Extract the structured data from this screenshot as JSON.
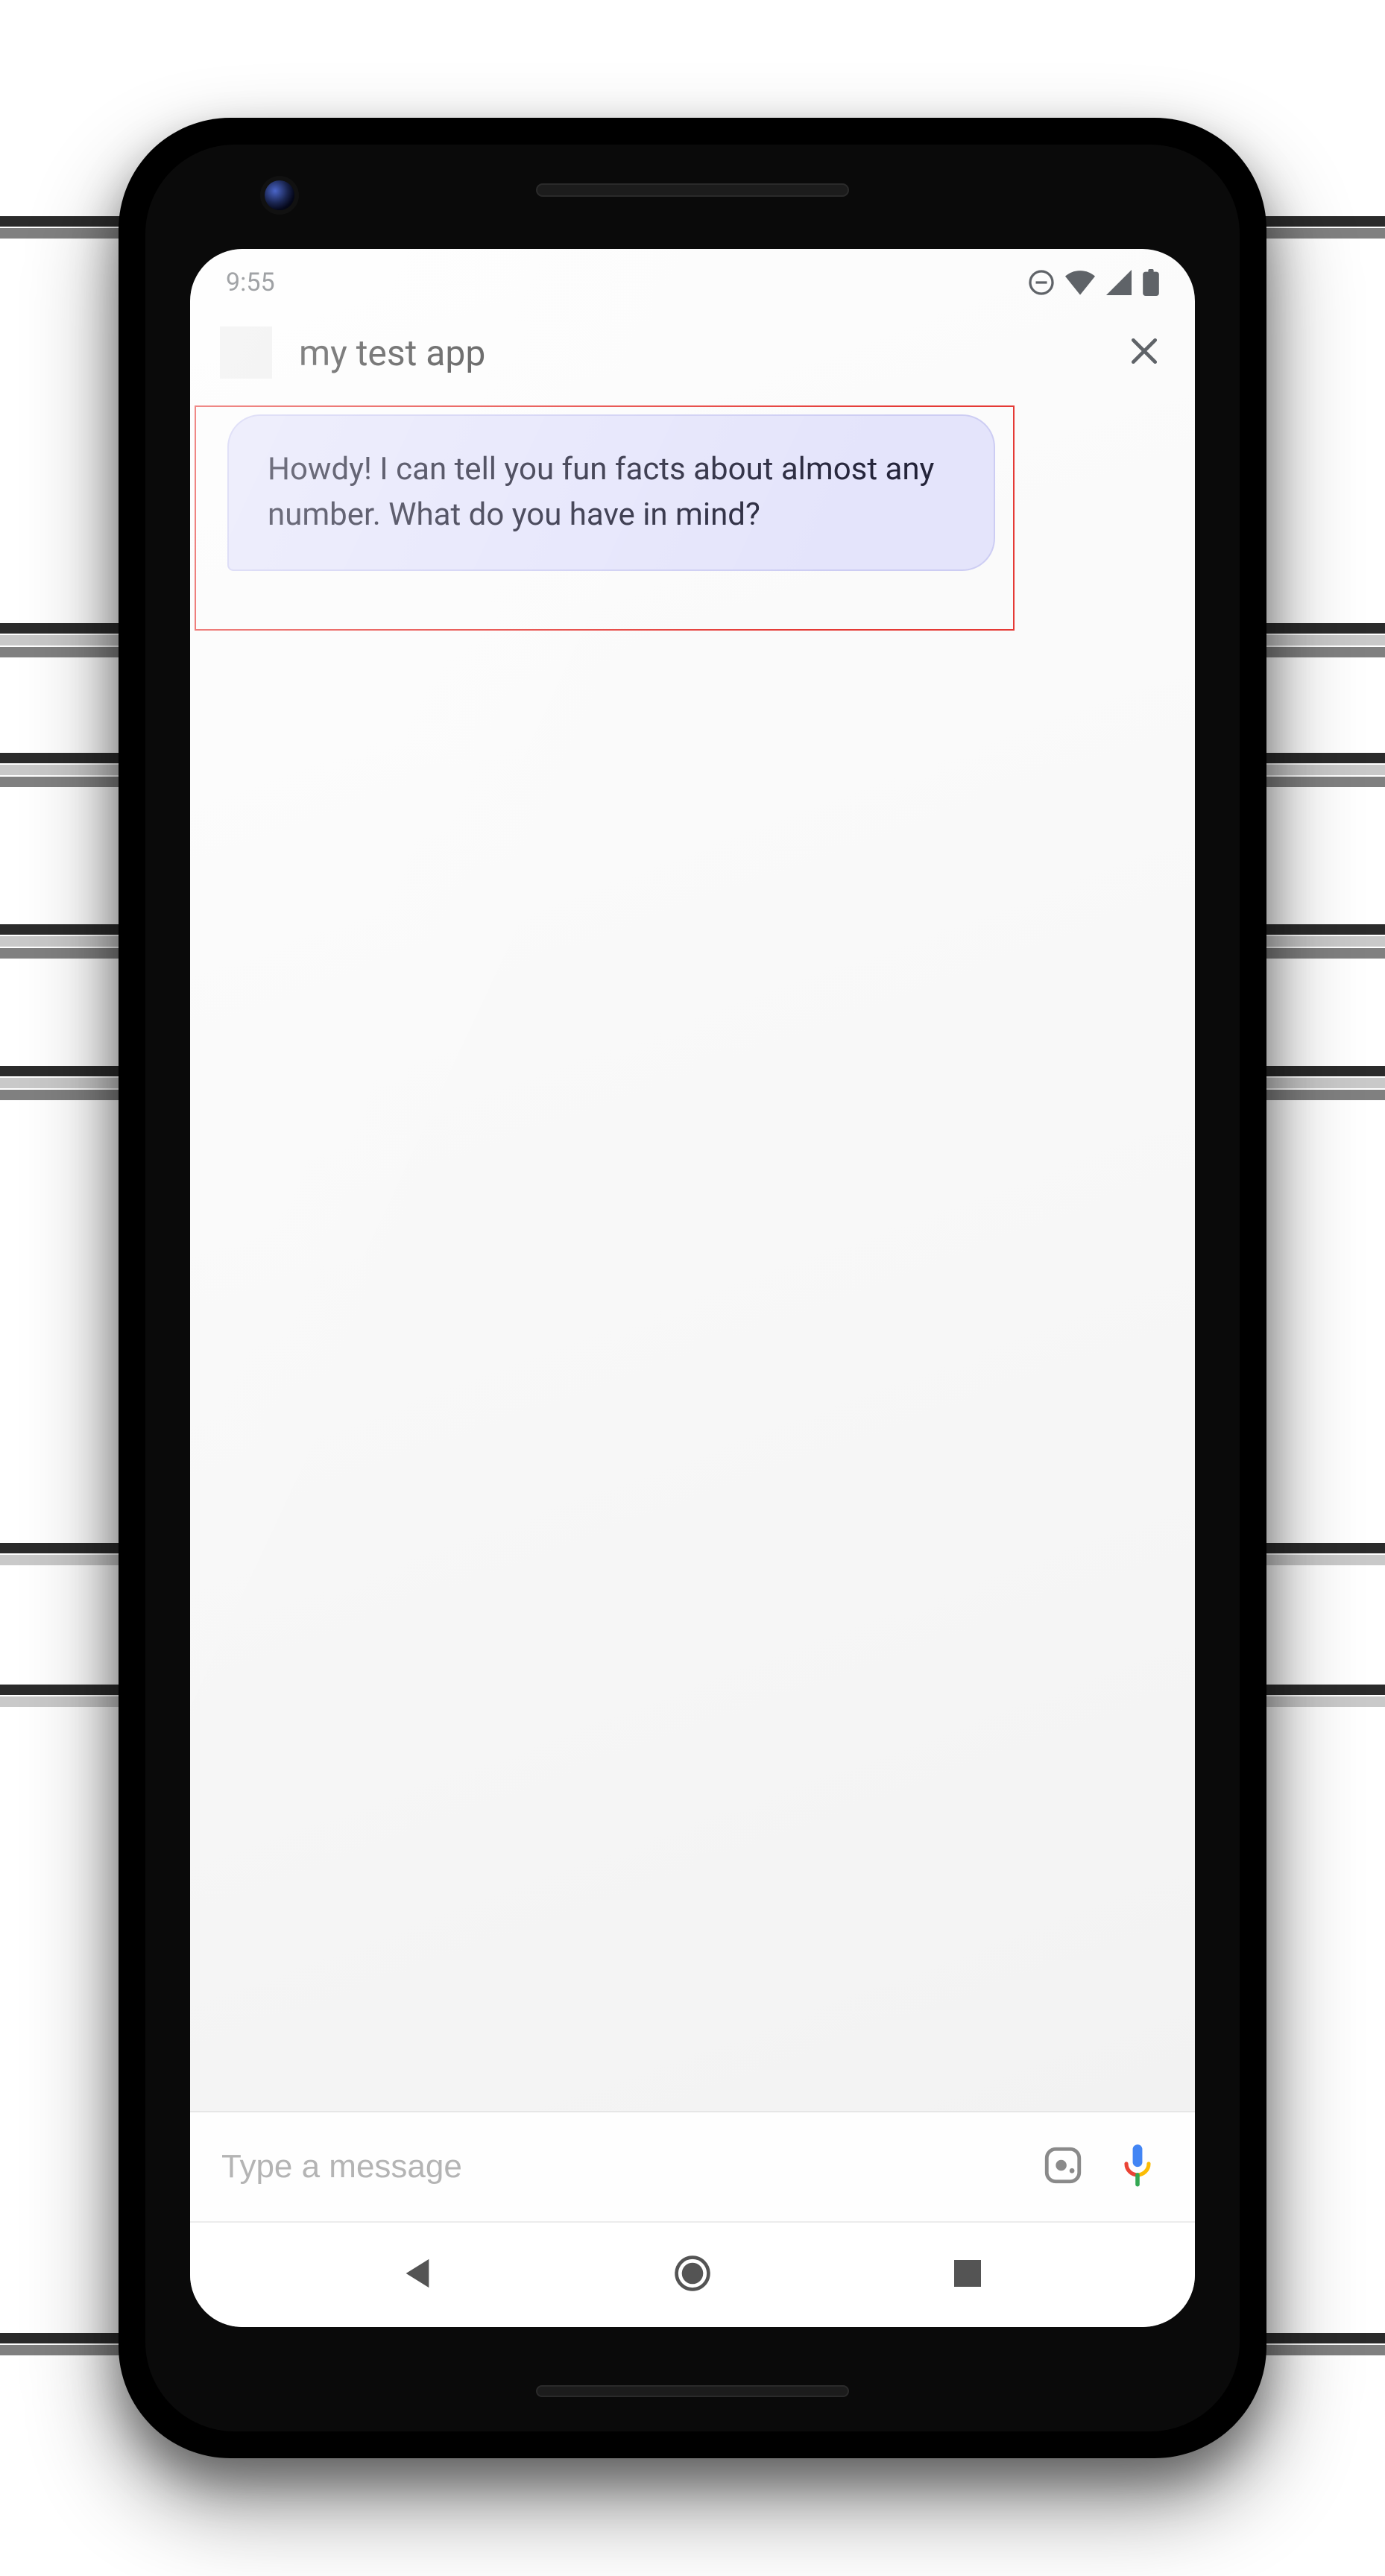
{
  "status_bar": {
    "time": "9:55",
    "icons": [
      "dnd",
      "wifi",
      "signal",
      "battery"
    ]
  },
  "header": {
    "title": "my test app",
    "close_label": "Close"
  },
  "conversation": {
    "messages": [
      {
        "from": "bot",
        "text": "Howdy! I can tell you fun facts about almost any number. What do you have in mind?"
      }
    ]
  },
  "highlight": {
    "color": "#e53935"
  },
  "composer": {
    "placeholder": "Type a message",
    "value": ""
  },
  "android_nav": {
    "buttons": [
      "back",
      "home",
      "recents"
    ]
  }
}
